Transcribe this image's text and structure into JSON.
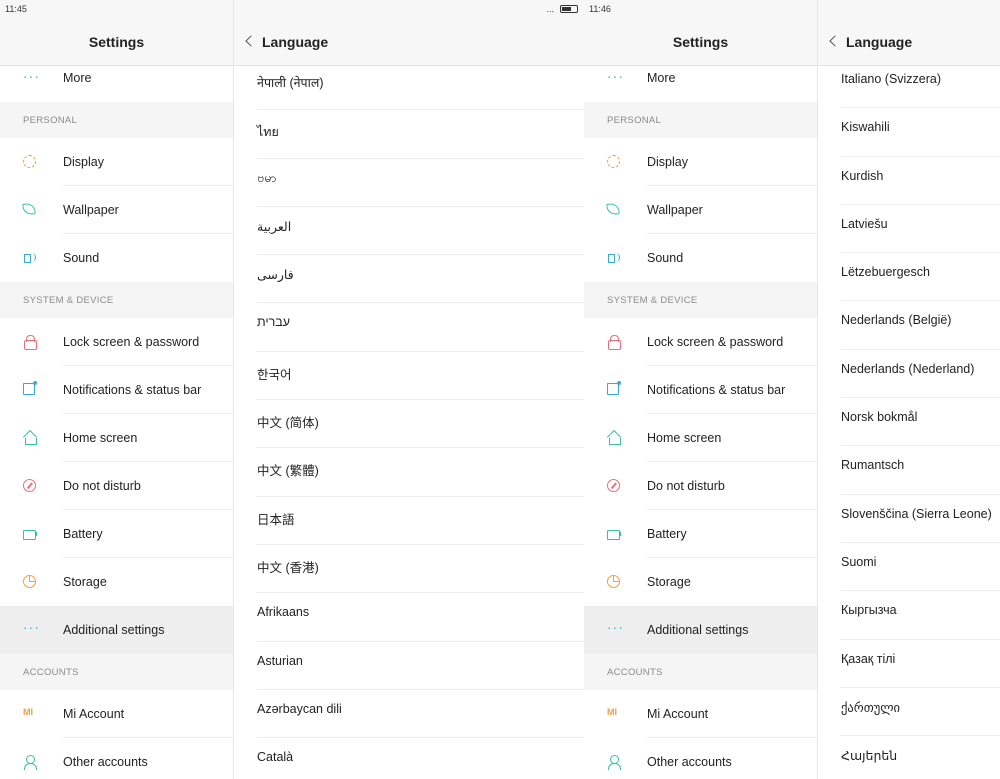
{
  "screen1": {
    "settings": {
      "status_time": "11:45",
      "title": "Settings",
      "top_item": {
        "label": "More",
        "icon": "more-dots-icon"
      },
      "sections": [
        {
          "header": "PERSONAL",
          "items": [
            {
              "label": "Display",
              "icon": "display-icon"
            },
            {
              "label": "Wallpaper",
              "icon": "wallpaper-icon"
            },
            {
              "label": "Sound",
              "icon": "sound-icon"
            }
          ]
        },
        {
          "header": "SYSTEM & DEVICE",
          "items": [
            {
              "label": "Lock screen & password",
              "icon": "lock-icon"
            },
            {
              "label": "Notifications & status bar",
              "icon": "notifications-icon"
            },
            {
              "label": "Home screen",
              "icon": "home-icon"
            },
            {
              "label": "Do not disturb",
              "icon": "do-not-disturb-icon"
            },
            {
              "label": "Battery",
              "icon": "battery-icon"
            },
            {
              "label": "Storage",
              "icon": "storage-icon"
            },
            {
              "label": "Additional settings",
              "icon": "more-dots-icon",
              "selected": true
            }
          ]
        },
        {
          "header": "ACCOUNTS",
          "items": [
            {
              "label": "Mi Account",
              "icon": "mi-account-icon"
            },
            {
              "label": "Other accounts",
              "icon": "person-icon"
            }
          ]
        }
      ]
    },
    "language": {
      "status_extra": "...",
      "title": "Language",
      "items": [
        "नेपाली (नेपाल)",
        "ไทย",
        "ဗမာ",
        "العربية",
        "فارسی",
        "עברית",
        "한국어",
        "中文 (简体)",
        "中文 (繁體)",
        "日本語",
        "中文 (香港)",
        "Afrikaans",
        "Asturian",
        "Azərbaycan dili",
        "Català"
      ]
    }
  },
  "screen2": {
    "settings": {
      "status_time": "11:46",
      "title": "Settings",
      "top_item": {
        "label": "More",
        "icon": "more-dots-icon"
      },
      "sections": [
        {
          "header": "PERSONAL",
          "items": [
            {
              "label": "Display",
              "icon": "display-icon"
            },
            {
              "label": "Wallpaper",
              "icon": "wallpaper-icon"
            },
            {
              "label": "Sound",
              "icon": "sound-icon"
            }
          ]
        },
        {
          "header": "SYSTEM & DEVICE",
          "items": [
            {
              "label": "Lock screen & password",
              "icon": "lock-icon"
            },
            {
              "label": "Notifications & status bar",
              "icon": "notifications-icon"
            },
            {
              "label": "Home screen",
              "icon": "home-icon"
            },
            {
              "label": "Do not disturb",
              "icon": "do-not-disturb-icon"
            },
            {
              "label": "Battery",
              "icon": "battery-icon"
            },
            {
              "label": "Storage",
              "icon": "storage-icon"
            },
            {
              "label": "Additional settings",
              "icon": "more-dots-icon",
              "selected": true
            }
          ]
        },
        {
          "header": "ACCOUNTS",
          "items": [
            {
              "label": "Mi Account",
              "icon": "mi-account-icon"
            },
            {
              "label": "Other accounts",
              "icon": "person-icon"
            }
          ]
        }
      ]
    },
    "language": {
      "title": "Language",
      "items": [
        "Italiano (Svizzera)",
        "Kiswahili",
        "Kurdish",
        "Latviešu",
        "Lëtzebuergesch",
        "Nederlands (België)",
        "Nederlands (Nederland)",
        "Norsk bokmål",
        "Rumantsch",
        "Slovenščina (Sierra Leone)",
        "Suomi",
        "Кыргызча",
        "Қазақ тілі",
        "ქართული",
        "Հայերեն"
      ]
    }
  }
}
